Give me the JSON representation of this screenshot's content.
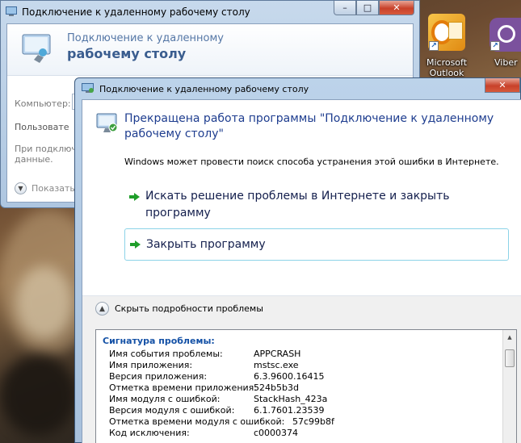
{
  "back_window": {
    "title": "Подключение к удаленному рабочему столу",
    "header_line1": "Подключение к удаленному",
    "header_line2": "рабочему столу",
    "computer_label": "Компьютер:",
    "user_label": "Пользовате",
    "info_line1": "При подключе",
    "info_line2": "данные.",
    "show_options": "Показать"
  },
  "caption": {
    "minimize": "–",
    "maximize": "□",
    "close": "✕"
  },
  "desktop": {
    "outlook_line1": "Microsoft",
    "outlook_line2": "Outlook 2010",
    "viber_label": "Viber"
  },
  "dialog": {
    "title": "Подключение к удаленному рабочему столу",
    "heading": "Прекращена работа программы \"Подключение к удаленному рабочему столу\"",
    "description": "Windows может провести поиск способа устранения этой ошибки в Интернете.",
    "options": [
      {
        "label": "Искать решение проблемы в Интернете и закрыть программу"
      },
      {
        "label": "Закрыть программу"
      }
    ],
    "details_toggle": "Скрыть подробности проблемы",
    "signature_title": "Сигнатура проблемы:",
    "signature": [
      {
        "name": "Имя события проблемы:",
        "value": "APPCRASH"
      },
      {
        "name": "Имя приложения:",
        "value": "mstsc.exe"
      },
      {
        "name": "Версия приложения:",
        "value": "6.3.9600.16415"
      },
      {
        "name": "Отметка времени приложения:",
        "value": "524b5b3d"
      },
      {
        "name": "Имя модуля с ошибкой:",
        "value": "StackHash_423a"
      },
      {
        "name": "Версия модуля с ошибкой:",
        "value": "6.1.7601.23539"
      },
      {
        "name": "Отметка времени модуля с ошибкой:",
        "value": "57c99b8f"
      },
      {
        "name": "Код исключения:",
        "value": "c0000374"
      }
    ]
  }
}
